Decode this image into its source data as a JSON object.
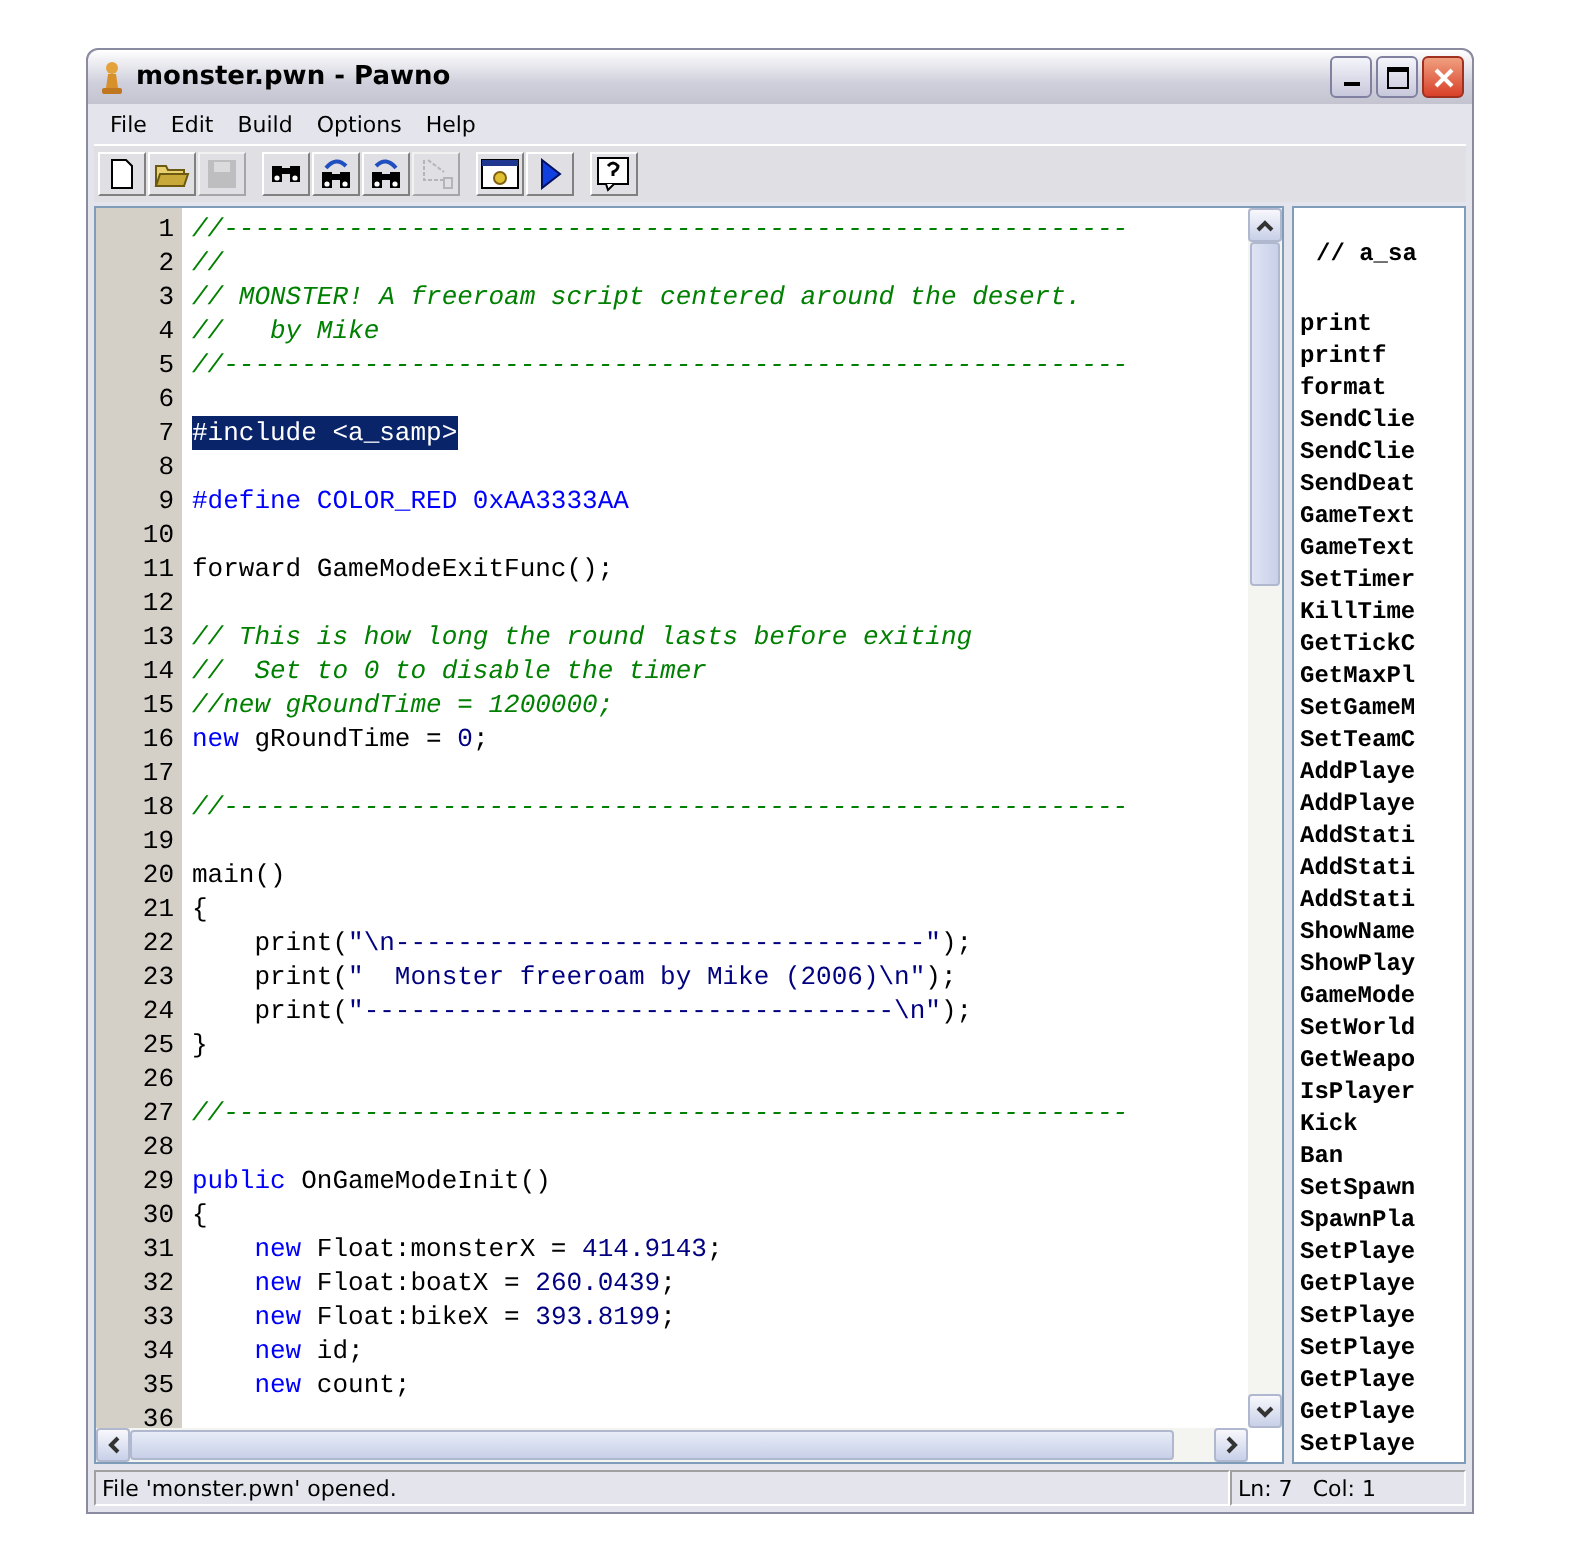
{
  "window": {
    "title": "monster.pwn - Pawno"
  },
  "menu": [
    "File",
    "Edit",
    "Build",
    "Options",
    "Help"
  ],
  "toolbar": [
    {
      "kind": "new",
      "disabled": false
    },
    {
      "kind": "open",
      "disabled": false
    },
    {
      "kind": "save",
      "disabled": true
    },
    {
      "kind": "sep"
    },
    {
      "kind": "find",
      "disabled": false
    },
    {
      "kind": "find-next",
      "disabled": false
    },
    {
      "kind": "replace",
      "disabled": false
    },
    {
      "kind": "goto",
      "disabled": true
    },
    {
      "kind": "sep"
    },
    {
      "kind": "compile",
      "disabled": false
    },
    {
      "kind": "run",
      "disabled": false
    },
    {
      "kind": "sep"
    },
    {
      "kind": "help",
      "disabled": false
    }
  ],
  "editor": {
    "lines": [
      {
        "number": "1",
        "selected": false,
        "segments": [
          {
            "kind": "comment",
            "text": "//----------------------------------------------------------"
          }
        ]
      },
      {
        "number": "2",
        "selected": false,
        "segments": [
          {
            "kind": "comment",
            "text": "//"
          }
        ]
      },
      {
        "number": "3",
        "selected": false,
        "segments": [
          {
            "kind": "comment",
            "text": "// MONSTER! A freeroam script centered around the desert."
          }
        ]
      },
      {
        "number": "4",
        "selected": false,
        "segments": [
          {
            "kind": "comment",
            "text": "//   by Mike"
          }
        ]
      },
      {
        "number": "5",
        "selected": false,
        "segments": [
          {
            "kind": "comment",
            "text": "//----------------------------------------------------------"
          }
        ]
      },
      {
        "number": "6",
        "selected": false
      },
      {
        "number": "7",
        "selected": true,
        "segments": [
          {
            "kind": "plain",
            "text": "#include <a_samp>"
          }
        ]
      },
      {
        "number": "8",
        "selected": false
      },
      {
        "number": "9",
        "selected": false,
        "segments": [
          {
            "kind": "keyword",
            "text": "#define COLOR_RED 0xAA3333AA"
          }
        ]
      },
      {
        "number": "10",
        "selected": false
      },
      {
        "number": "11",
        "selected": false,
        "segments": [
          {
            "kind": "plain",
            "text": "forward GameModeExitFunc();"
          }
        ]
      },
      {
        "number": "12",
        "selected": false
      },
      {
        "number": "13",
        "selected": false,
        "segments": [
          {
            "kind": "comment",
            "text": "// This is how long the round lasts before exiting"
          }
        ]
      },
      {
        "number": "14",
        "selected": false,
        "segments": [
          {
            "kind": "comment",
            "text": "//  Set to 0 to disable the timer"
          }
        ]
      },
      {
        "number": "15",
        "selected": false,
        "segments": [
          {
            "kind": "comment",
            "text": "//new gRoundTime = 1200000;"
          }
        ]
      },
      {
        "number": "16",
        "selected": false,
        "segments": [
          {
            "kind": "keyword",
            "text": "new"
          },
          {
            "kind": "plain",
            "text": " gRoundTime = "
          },
          {
            "kind": "number",
            "text": "0"
          },
          {
            "kind": "plain",
            "text": ";"
          }
        ]
      },
      {
        "number": "17",
        "selected": false
      },
      {
        "number": "18",
        "selected": false,
        "segments": [
          {
            "kind": "comment",
            "text": "//----------------------------------------------------------"
          }
        ]
      },
      {
        "number": "19",
        "selected": false
      },
      {
        "number": "20",
        "selected": false,
        "segments": [
          {
            "kind": "plain",
            "text": "main()"
          }
        ]
      },
      {
        "number": "21",
        "selected": false,
        "segments": [
          {
            "kind": "plain",
            "text": "{"
          }
        ]
      },
      {
        "number": "22",
        "selected": false,
        "segments": [
          {
            "kind": "plain",
            "text": "    print("
          },
          {
            "kind": "string",
            "text": "\"\\n----------------------------------\""
          },
          {
            "kind": "plain",
            "text": ");"
          }
        ]
      },
      {
        "number": "23",
        "selected": false,
        "segments": [
          {
            "kind": "plain",
            "text": "    print("
          },
          {
            "kind": "string",
            "text": "\"  Monster freeroam by Mike (2006)\\n\""
          },
          {
            "kind": "plain",
            "text": ");"
          }
        ]
      },
      {
        "number": "24",
        "selected": false,
        "segments": [
          {
            "kind": "plain",
            "text": "    print("
          },
          {
            "kind": "string",
            "text": "\"----------------------------------\\n\""
          },
          {
            "kind": "plain",
            "text": ");"
          }
        ]
      },
      {
        "number": "25",
        "selected": false,
        "segments": [
          {
            "kind": "plain",
            "text": "}"
          }
        ]
      },
      {
        "number": "26",
        "selected": false
      },
      {
        "number": "27",
        "selected": false,
        "segments": [
          {
            "kind": "comment",
            "text": "//----------------------------------------------------------"
          }
        ]
      },
      {
        "number": "28",
        "selected": false
      },
      {
        "number": "29",
        "selected": false,
        "segments": [
          {
            "kind": "keyword",
            "text": "public"
          },
          {
            "kind": "plain",
            "text": " OnGameModeInit()"
          }
        ]
      },
      {
        "number": "30",
        "selected": false,
        "segments": [
          {
            "kind": "plain",
            "text": "{"
          }
        ]
      },
      {
        "number": "31",
        "selected": false,
        "segments": [
          {
            "kind": "keyword",
            "text": "    new"
          },
          {
            "kind": "plain",
            "text": " Float:monsterX = "
          },
          {
            "kind": "number",
            "text": "414.9143"
          },
          {
            "kind": "plain",
            "text": ";"
          }
        ]
      },
      {
        "number": "32",
        "selected": false,
        "segments": [
          {
            "kind": "keyword",
            "text": "    new"
          },
          {
            "kind": "plain",
            "text": " Float:boatX = "
          },
          {
            "kind": "number",
            "text": "260.0439"
          },
          {
            "kind": "plain",
            "text": ";"
          }
        ]
      },
      {
        "number": "33",
        "selected": false,
        "segments": [
          {
            "kind": "keyword",
            "text": "    new"
          },
          {
            "kind": "plain",
            "text": " Float:bikeX = "
          },
          {
            "kind": "number",
            "text": "393.8199"
          },
          {
            "kind": "plain",
            "text": ";"
          }
        ]
      },
      {
        "number": "34",
        "selected": false,
        "segments": [
          {
            "kind": "keyword",
            "text": "    new"
          },
          {
            "kind": "plain",
            "text": " id;"
          }
        ]
      },
      {
        "number": "35",
        "selected": false,
        "segments": [
          {
            "kind": "keyword",
            "text": "    new"
          },
          {
            "kind": "plain",
            "text": " count;"
          }
        ]
      },
      {
        "number": "36",
        "selected": false
      }
    ]
  },
  "function_list": {
    "header": "// a_sa",
    "items": [
      "print",
      "printf",
      "format",
      "SendClie",
      "SendClie",
      "SendDeat",
      "GameText",
      "GameText",
      "SetTimer",
      "KillTime",
      "GetTickC",
      "GetMaxPl",
      "SetGameM",
      "SetTeamC",
      "AddPlaye",
      "AddPlaye",
      "AddStati",
      "AddStati",
      "AddStati",
      "ShowName",
      "ShowPlay",
      "GameMode",
      "SetWorld",
      "GetWeapo",
      "IsPlayer",
      "Kick",
      "Ban",
      "SetSpawn",
      "SpawnPla",
      "SetPlaye",
      "GetPlaye",
      "SetPlaye",
      "SetPlaye",
      "GetPlaye",
      "GetPlaye",
      "SetPlaye"
    ]
  },
  "status_bar": {
    "message": "File 'monster.pwn' opened.",
    "line": "Ln: 7",
    "column": "Col: 1"
  }
}
